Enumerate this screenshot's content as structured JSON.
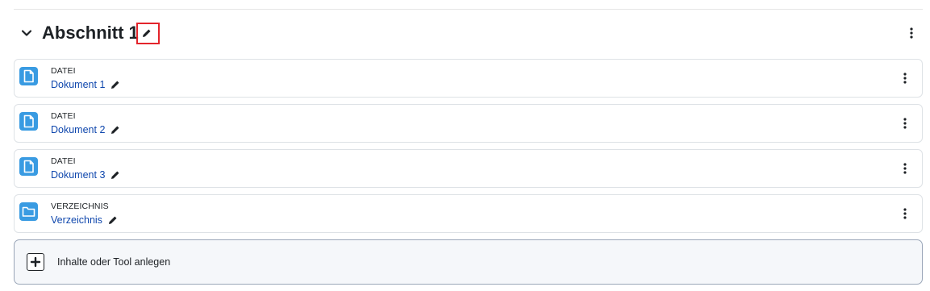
{
  "section": {
    "title": "Abschnitt 1"
  },
  "activities": [
    {
      "type": "DATEI",
      "name": "Dokument 1",
      "icon": "file-icon"
    },
    {
      "type": "DATEI",
      "name": "Dokument 2",
      "icon": "file-icon"
    },
    {
      "type": "DATEI",
      "name": "Dokument 3",
      "icon": "file-icon"
    },
    {
      "type": "VERZEICHNIS",
      "name": "Verzeichnis",
      "icon": "folder-icon"
    }
  ],
  "add_content": {
    "label": "Inhalte oder Tool anlegen"
  },
  "colors": {
    "icon_blue": "#399be2",
    "link_blue": "#0f47ad",
    "highlight_red": "#e3242b",
    "add_border": "#9aa6b8"
  }
}
